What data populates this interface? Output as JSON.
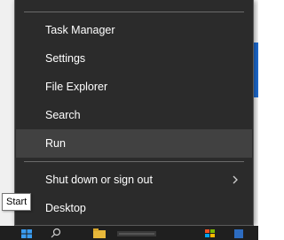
{
  "menu": {
    "items": [
      {
        "label": "Task Manager"
      },
      {
        "label": "Settings"
      },
      {
        "label": "File Explorer"
      },
      {
        "label": "Search"
      },
      {
        "label": "Run"
      },
      {
        "label": "Shut down or sign out"
      },
      {
        "label": "Desktop"
      }
    ],
    "hovered_item": "Run"
  },
  "tooltip": {
    "text": "Start"
  },
  "taskbar": {
    "icons": [
      "start-icon",
      "search-icon",
      "file-explorer-icon",
      "app-icon",
      "store-icon"
    ]
  },
  "colors": {
    "menu_background": "#2b2b2b",
    "menu_hover": "#414141",
    "text": "#ffffff",
    "separator": "#6a6a6a",
    "accent": "#1e6fd9"
  }
}
